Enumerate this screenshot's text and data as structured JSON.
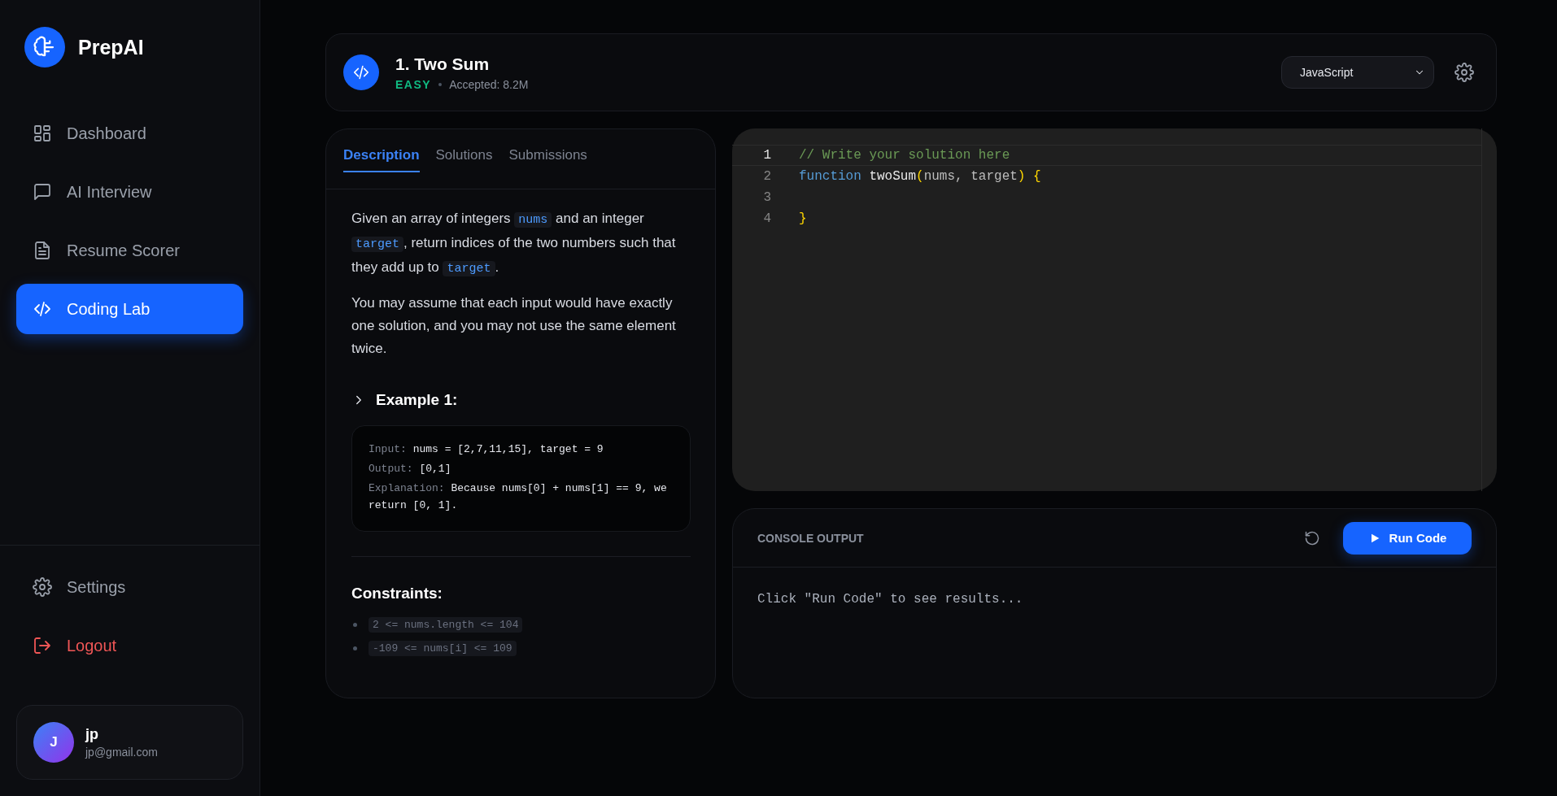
{
  "sidebar": {
    "brand": "PrepAI",
    "nav": [
      {
        "label": "Dashboard",
        "kind": "grid",
        "selected": false
      },
      {
        "label": "AI Interview",
        "kind": "chat",
        "selected": false
      },
      {
        "label": "Resume Scorer",
        "kind": "doc",
        "selected": false
      },
      {
        "label": "Coding Lab",
        "kind": "code",
        "selected": true
      }
    ],
    "bottom": [
      {
        "label": "Settings",
        "kind": "settings"
      },
      {
        "label": "Logout",
        "kind": "logout"
      }
    ],
    "user": {
      "initial": "J",
      "name": "jp",
      "email": "jp@gmail.com"
    }
  },
  "problem": {
    "title": "1. Two Sum",
    "difficulty": "EASY",
    "accepted": "Accepted: 8.2M",
    "language": "JavaScript"
  },
  "tabs": [
    {
      "label": "Description",
      "selected": true
    },
    {
      "label": "Solutions",
      "selected": false
    },
    {
      "label": "Submissions",
      "selected": false
    }
  ],
  "description": [
    [
      {
        "kind": "text",
        "text": "Given an array of integers "
      },
      {
        "kind": "code",
        "text": "nums"
      },
      {
        "kind": "text",
        "text": " and an integer "
      },
      {
        "kind": "code",
        "text": "target"
      },
      {
        "kind": "text",
        "text": ", return indices of the two numbers such that they add up to "
      },
      {
        "kind": "code",
        "text": "target"
      },
      {
        "kind": "text",
        "text": "."
      }
    ],
    [
      {
        "kind": "text",
        "text": "You may assume that each input would have exactly one solution, and you may not use the same element twice."
      }
    ]
  ],
  "example": {
    "title": "Example 1:",
    "lines": [
      {
        "label": "Input:",
        "value": "nums = [2,7,11,15], target = 9"
      },
      {
        "label": "Output:",
        "value": "[0,1]"
      },
      {
        "label": "Explanation:",
        "value": "Because nums[0] + nums[1] == 9, we return [0, 1]."
      }
    ]
  },
  "constraints": {
    "title": "Constraints:",
    "items": [
      "2 <= nums.length <= 104",
      "-109 <= nums[i] <= 109"
    ]
  },
  "editor": {
    "lines": [
      {
        "number": "1",
        "active": true,
        "tokens": [
          {
            "kind": "comment",
            "text": "// Write your solution here"
          }
        ]
      },
      {
        "number": "2",
        "active": false,
        "tokens": [
          {
            "kind": "keyword",
            "text": "function"
          },
          {
            "kind": "name",
            "text": " twoSum"
          },
          {
            "kind": "bracket",
            "text": "("
          },
          {
            "kind": "param",
            "text": "nums, target"
          },
          {
            "kind": "bracket",
            "text": ") {"
          }
        ]
      },
      {
        "number": "3",
        "active": false
      },
      {
        "number": "4",
        "active": false,
        "tokens": [
          {
            "kind": "bracket",
            "text": "}"
          }
        ]
      }
    ]
  },
  "console": {
    "title": "CONSOLE OUTPUT",
    "run_label": "Run Code",
    "output": "Click \"Run Code\" to see results..."
  }
}
